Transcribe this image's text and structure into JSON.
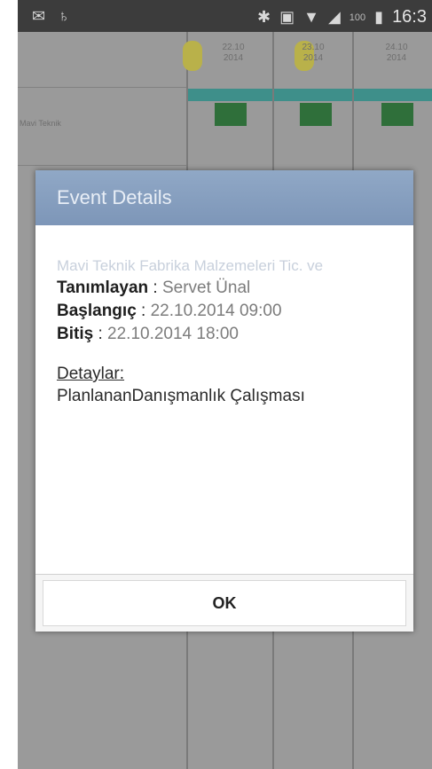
{
  "status_bar": {
    "time": "16:3",
    "battery_pct": "100"
  },
  "background_app": {
    "columns": [
      {
        "header": "22.10\n2014"
      },
      {
        "header": "23.10\n2014"
      },
      {
        "header": "24.10\n2014"
      }
    ],
    "row_label": "Mavi Teknik"
  },
  "dialog": {
    "title": "Event Details",
    "event_title": "Mavi Teknik Fabrika Malzemeleri Tic. ve",
    "defined_by_label": "Tanımlayan",
    "defined_by_value": "Servet Ünal",
    "start_label": "Başlangıç",
    "start_value": "22.10.2014 09:00",
    "end_label": "Bitiş",
    "end_value": "22.10.2014 18:00",
    "details_label": "Detaylar:",
    "details_value": "PlanlananDanışmanlık Çalışması",
    "ok_label": "OK"
  }
}
